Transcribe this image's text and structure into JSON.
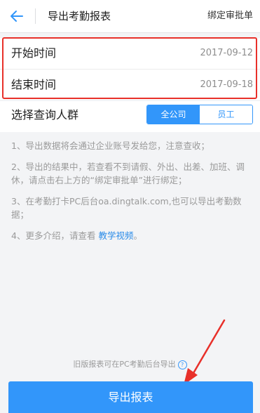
{
  "header": {
    "title": "导出考勤报表",
    "right_action": "绑定审批单"
  },
  "dates": {
    "start_label": "开始时间",
    "start_value": "2017-09-12",
    "end_label": "结束时间",
    "end_value": "2017-09-18"
  },
  "group": {
    "label": "选择查询人群",
    "options": [
      "全公司",
      "员工"
    ],
    "selected": "全公司"
  },
  "notes": {
    "n1": "1、导出数据将会通过企业账号发给您，注意查收；",
    "n2": "2、导出的结果中，若查看不到请假、外出、出差、加班、调休，请点击右上方的“绑定审批单”进行绑定；",
    "n3": "3、在考勤打卡PC后台oa.dingtalk.com,也可以导出考勤数据；",
    "n4_prefix": "4、更多介绍，请查看",
    "n4_link": "教学视频",
    "n4_suffix": "。"
  },
  "footer": {
    "old_text": "旧版报表可在PC考勤后台导出",
    "help_icon": "?",
    "export_button": "导出报表"
  },
  "colors": {
    "accent": "#3296fa",
    "annotation": "#e8302a"
  }
}
